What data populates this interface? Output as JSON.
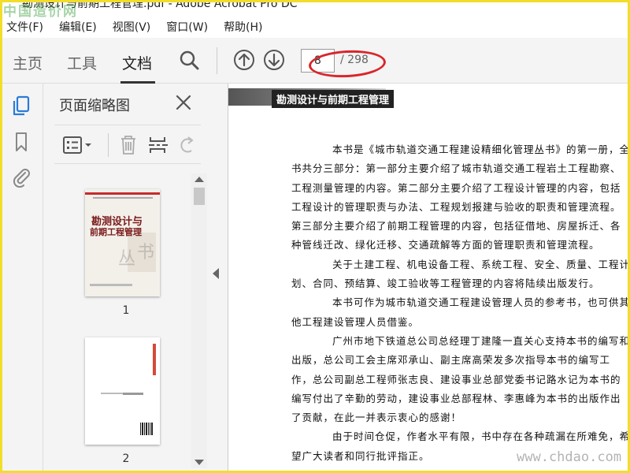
{
  "window": {
    "title": "勘测设计与前期工程管理.pdf - Adobe Acrobat Pro DC"
  },
  "watermarks": {
    "top_left": "中国造价网",
    "bottom_right": "www.chdao.com"
  },
  "menu": [
    "文件(F)",
    "编辑(E)",
    "视图(V)",
    "窗口(W)",
    "帮助(H)"
  ],
  "toolbar": {
    "tabs": [
      "主页",
      "工具",
      "文档"
    ],
    "active_tab": "文档",
    "current_page": "8",
    "total_pages": "/ 298"
  },
  "thumbnails_panel": {
    "title": "页面缩略图",
    "items": [
      {
        "label": "1",
        "cover_title_line1": "勘测设计与",
        "cover_title_line2": "前期工程管理",
        "cover_big": "丛",
        "cover_big2": "书"
      },
      {
        "label": "2"
      }
    ]
  },
  "document": {
    "header": "勘测设计与前期工程管理",
    "lines": [
      "本书是《城市轨道交通工程建设精细化管理丛书》的第一册，全",
      "书共分三部分：第一部分主要介绍了城市轨道交通工程岩土工程勘察、",
      "工程测量管理的内容。第二部分主要介绍了工程设计管理的内容，包括",
      "工程设计的管理职责与办法、工程规划报建与验收的职责和管理流程。",
      "第三部分主要介绍了前期工程管理的内容，包括征借地、房屋拆迁、各",
      "种管线迁改、绿化迁移、交通疏解等方面的管理职责和管理流程。",
      "关于土建工程、机电设备工程、系统工程、安全、质量、工程计",
      "划、合同、预结算、竣工验收等工程管理的内容将陆续出版发行。",
      "本书可作为城市轨道交通工程建设管理人员的参考书，也可供其",
      "他工程建设管理人员借鉴。",
      "广州市地下铁道总公司总经理丁建隆一直关心支持本书的编写和",
      "出版，总公司工会主席邓承山、副主席高荣发多次指导本书的编写工",
      "作，总公司副总工程师张志良、建设事业总部党委书记路水记为本书的",
      "编写付出了辛勤的劳动，建设事业总部程林、李惠峰为本书的出版作出",
      "了贡献，在此一并表示衷心的感谢！",
      "由于时间仓促，作者水平有限，书中存在各种疏漏在所难免，希",
      "望广大读者和同行批评指正。"
    ],
    "indented": [
      0,
      6,
      8,
      10,
      15
    ]
  },
  "colors": {
    "frame": "#f2dd2a",
    "annotation": "#d9262b",
    "accent_blue": "#2b7bd6"
  }
}
